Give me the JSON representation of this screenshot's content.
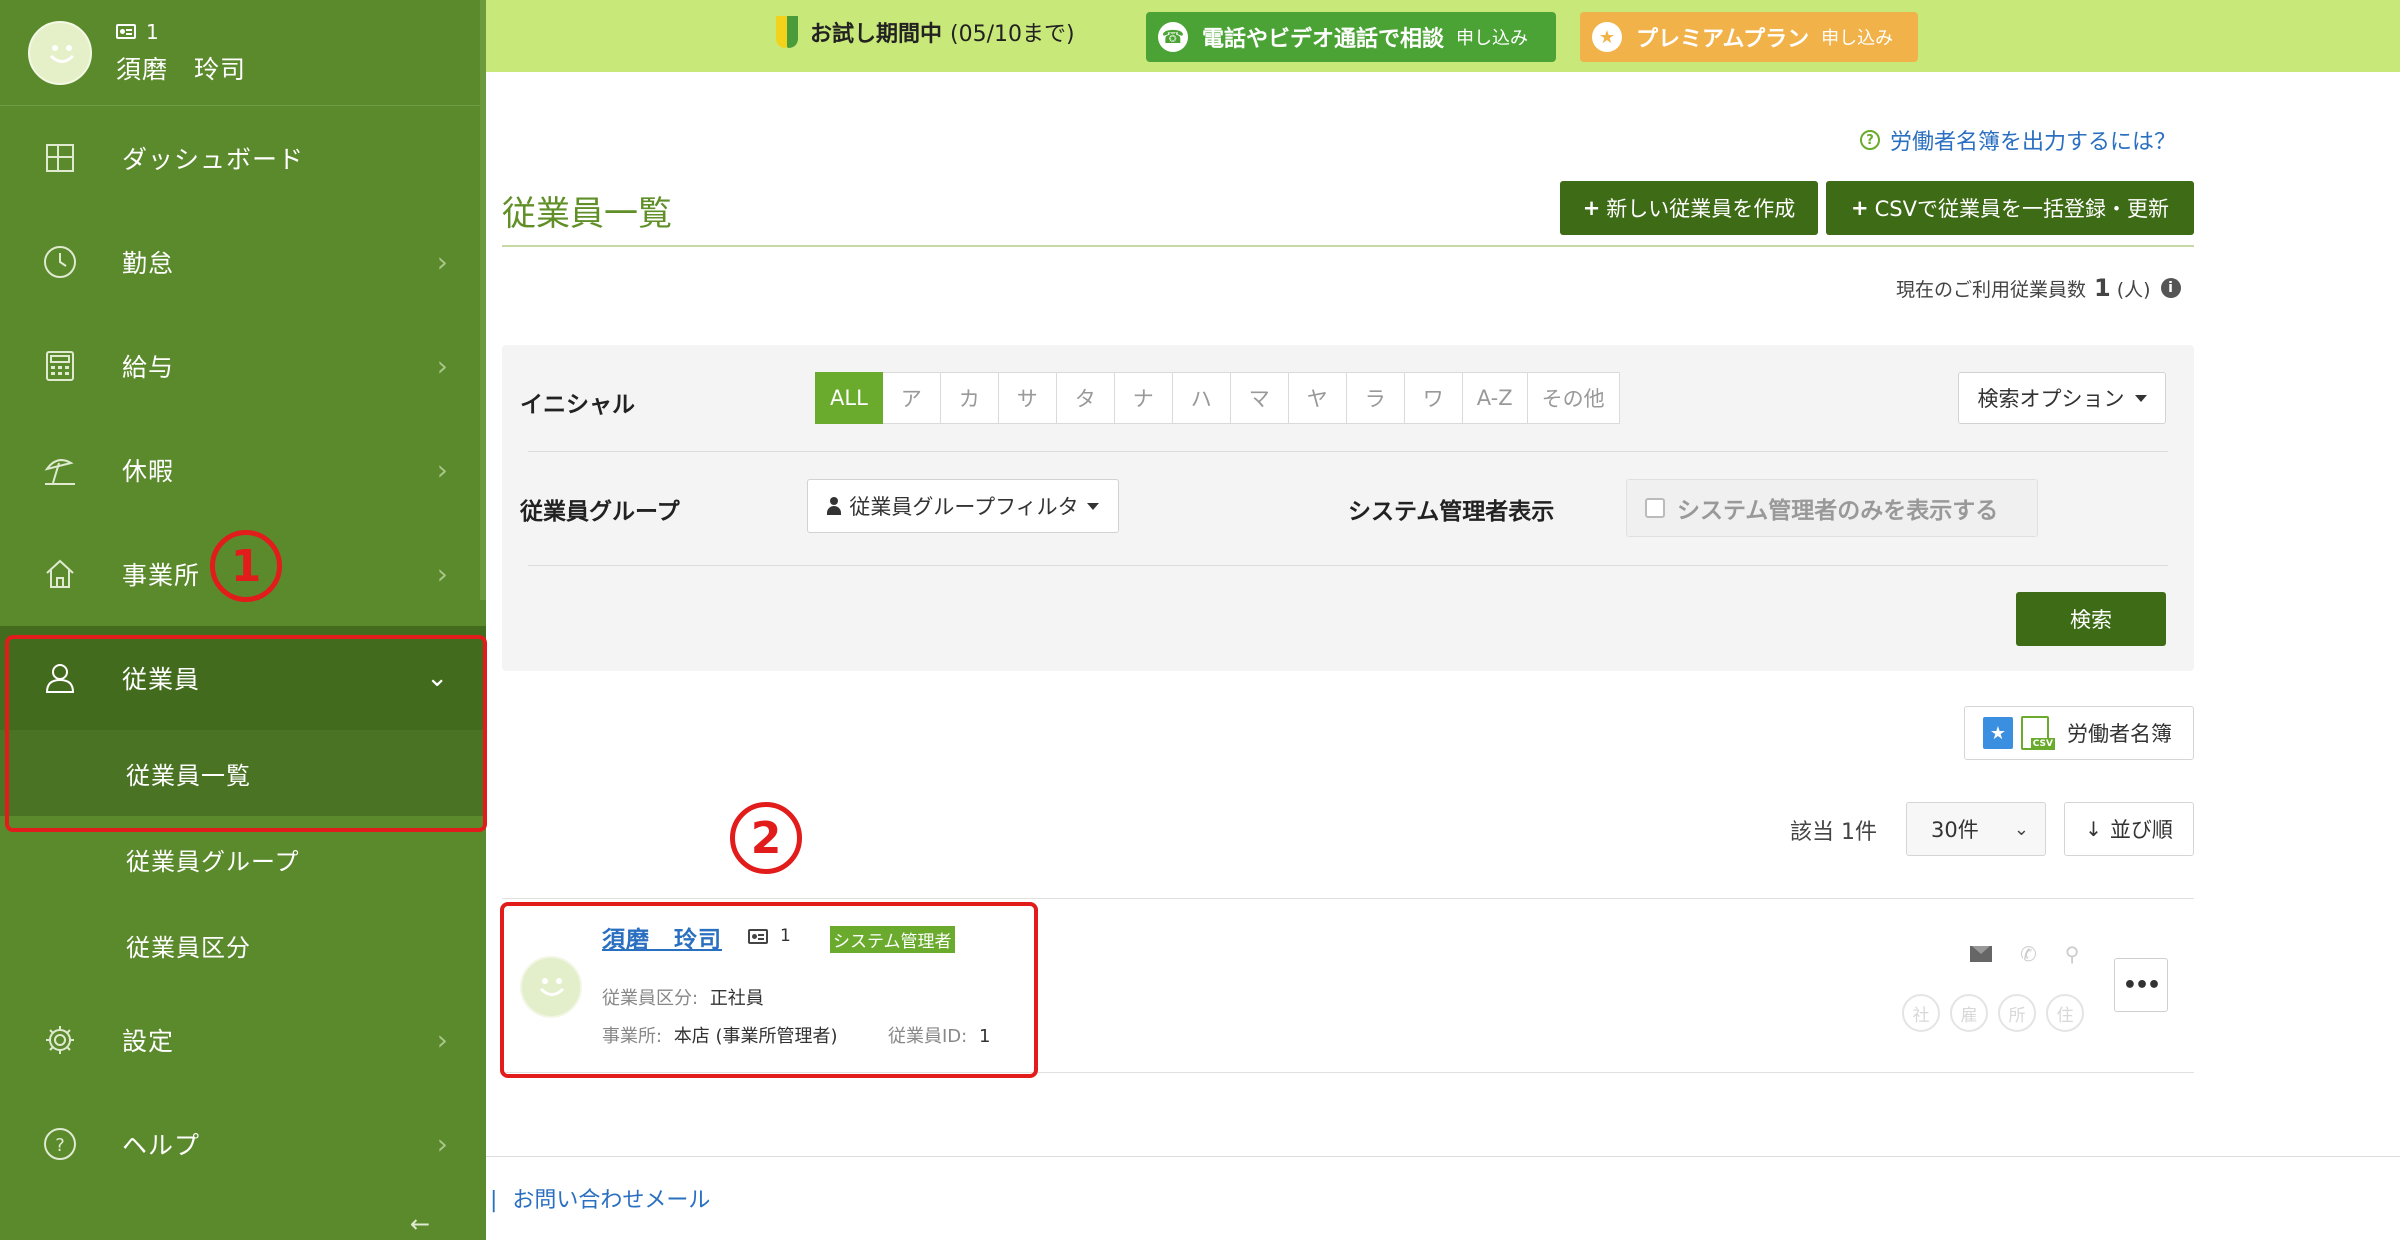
{
  "profile": {
    "id": "1",
    "name": "須磨　玲司"
  },
  "sidebar": {
    "items": [
      {
        "label": "ダッシュボード",
        "icon": "dashboard-icon"
      },
      {
        "label": "勤怠",
        "icon": "clock-icon"
      },
      {
        "label": "給与",
        "icon": "calculator-icon"
      },
      {
        "label": "休暇",
        "icon": "umbrella-icon"
      },
      {
        "label": "事業所",
        "icon": "home-icon"
      },
      {
        "label": "従業員",
        "icon": "user-icon"
      },
      {
        "label": "設定",
        "icon": "gear-icon"
      },
      {
        "label": "ヘルプ",
        "icon": "help-icon"
      }
    ],
    "sub_items": [
      "従業員一覧",
      "従業員グループ",
      "従業員区分"
    ],
    "collapse": "←"
  },
  "annotations": {
    "marker1": "1",
    "marker2": "2"
  },
  "banner": {
    "trial_label": "お試し期間中",
    "trial_period": "(05/10まで)",
    "consult_label": "電話やビデオ通話で相談",
    "consult_apply": "申し込み",
    "premium_label": "プレミアムプラン",
    "premium_apply": "申し込み"
  },
  "help_link": "労働者名簿を出力するには？",
  "page_title": "従業員一覧",
  "buttons": {
    "new_employee": "新しい従業員を作成",
    "csv_import": "CSVで従業員を一括登録・更新",
    "search": "検索",
    "search_options": "検索オプション",
    "group_filter": "従業員グループフィルタ",
    "roster": "労働者名簿",
    "sort": "並び順",
    "more": "•••"
  },
  "usage": {
    "label": "現在のご利用従業員数",
    "count": "1",
    "unit": "(人)"
  },
  "filters": {
    "initial_label": "イニシャル",
    "initials": [
      "ALL",
      "ア",
      "カ",
      "サ",
      "タ",
      "ナ",
      "ハ",
      "マ",
      "ヤ",
      "ラ",
      "ワ",
      "A-Z",
      "その他"
    ],
    "active_initial": "ALL",
    "group_label": "従業員グループ",
    "sysadmin_label": "システム管理者表示",
    "sysadmin_checkbox": "システム管理者のみを表示する"
  },
  "results": {
    "count_text": "該当 1件",
    "per_page": "30件"
  },
  "employee": {
    "name": "須磨　玲司",
    "id": "1",
    "badge": "システム管理者",
    "category_label": "従業員区分:",
    "category_value": "正社員",
    "office_label": "事業所:",
    "office_value": "本店 (事業所管理者)",
    "empid_label": "従業員ID:",
    "empid_value": "1",
    "circles": [
      "社",
      "雇",
      "所",
      "住"
    ]
  },
  "footer": {
    "contact": "お問い合わせメール"
  },
  "colors": {
    "sidebar": "#5b8a2d",
    "accent": "#6aab2d",
    "dark_button": "#3e6b16",
    "banner": "#c9e87a",
    "annotation": "#e21b1b"
  }
}
